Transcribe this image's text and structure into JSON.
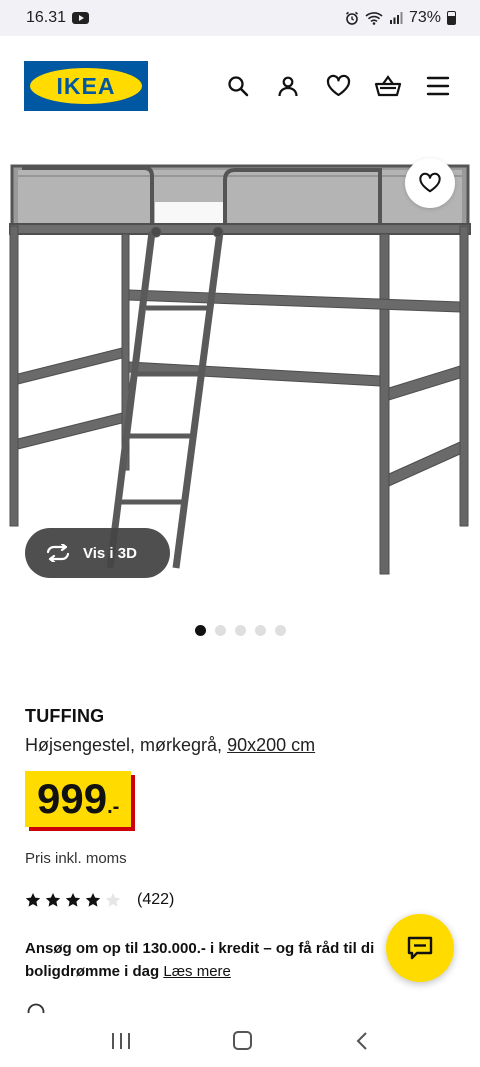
{
  "status_bar": {
    "time": "16.31",
    "battery": "73%"
  },
  "header": {
    "logo_text": "IKEA",
    "icons": [
      "search-icon",
      "profile-icon",
      "heart-icon",
      "basket-icon",
      "menu-icon"
    ]
  },
  "gallery": {
    "view_3d_label": "Vis i 3D",
    "dot_count": 5,
    "active_dot": 0
  },
  "product": {
    "name": "TUFFING",
    "description": "Højsengestel, mørkegrå, ",
    "size": "90x200 cm",
    "price_main": "999",
    "price_suffix": ".-",
    "vat_note": "Pris inkl. moms",
    "rating_stars": 4,
    "rating_max": 5,
    "rating_count": "(422)"
  },
  "credit": {
    "text_line1": "Ansøg om op til 130.000.- i kredit – og få råd til di",
    "text_line2": "boligdrømme i dag",
    "link": "Læs mere"
  },
  "colors": {
    "ikea_blue": "#0058a3",
    "ikea_yellow": "#ffdb00",
    "price_shadow": "#cc0008"
  }
}
